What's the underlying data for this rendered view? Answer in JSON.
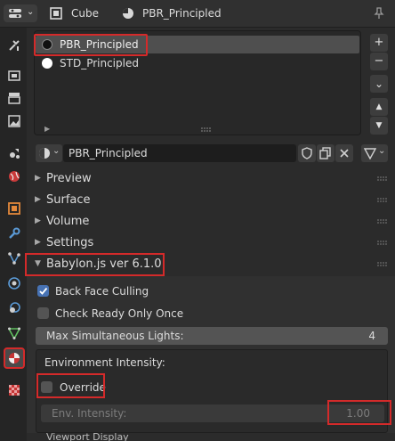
{
  "header": {
    "object_name": "Cube",
    "material_name": "PBR_Principled"
  },
  "material_slots": [
    {
      "name": "PBR_Principled",
      "selected": true,
      "dot_color": "#111111"
    },
    {
      "name": "STD_Principled",
      "selected": false,
      "dot_color": "#ffffff"
    }
  ],
  "material_field": {
    "value": "PBR_Principled"
  },
  "side_buttons": {
    "add": "+",
    "remove": "−",
    "menu": "⌄",
    "up": "▲",
    "down": "▼"
  },
  "panels": {
    "preview": "Preview",
    "surface": "Surface",
    "volume": "Volume",
    "settings": "Settings",
    "babylon": "Babylon.js ver 6.1.0"
  },
  "babylon": {
    "back_face_culling": {
      "label": "Back Face Culling",
      "checked": true
    },
    "check_ready_only_once": {
      "label": "Check Ready Only Once",
      "checked": false
    },
    "max_lights": {
      "label": "Max Simultaneous Lights:",
      "value": "4"
    },
    "environment": {
      "title": "Environment Intensity:",
      "override_label": "Override",
      "override_checked": false,
      "intensity_label": "Env. Intensity:",
      "intensity_value": "1.00"
    }
  },
  "footer_partial": "Viewport Display",
  "colors": {
    "accent_blue": "#4772b3",
    "highlight_red": "#d42a2a",
    "material_tab": "#b52a2a"
  }
}
